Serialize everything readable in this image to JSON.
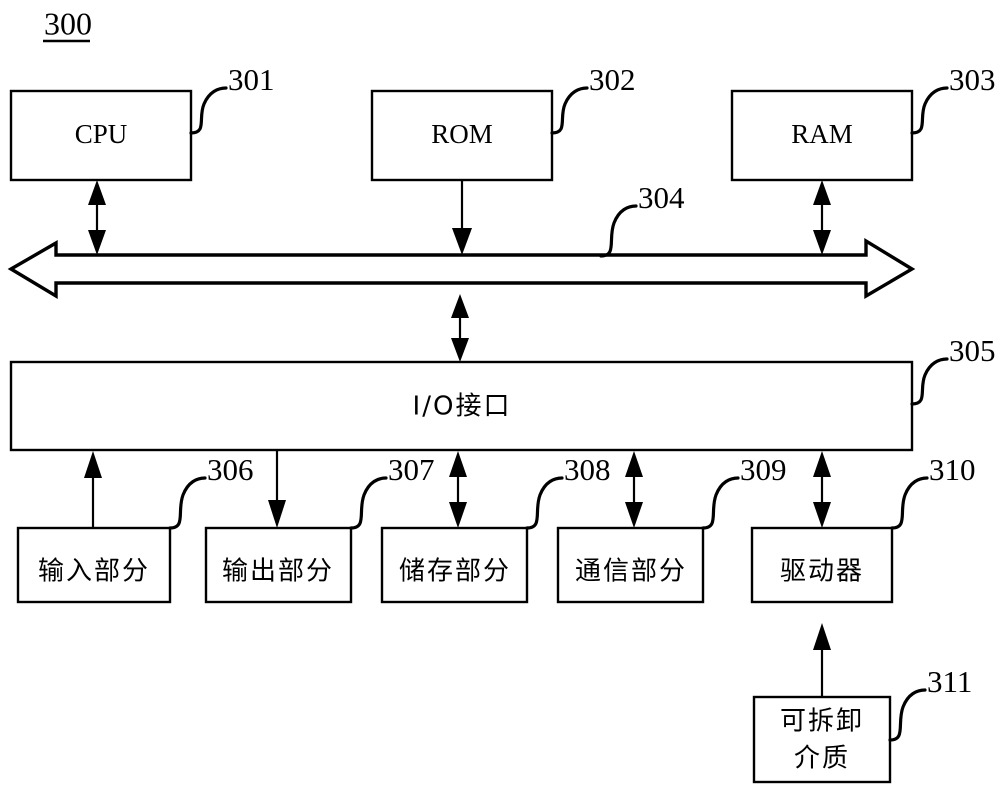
{
  "figure": {
    "number": "300",
    "title_underlined": true
  },
  "blocks": {
    "cpu": {
      "label": "CPU",
      "ref": "301"
    },
    "rom": {
      "label": "ROM",
      "ref": "302"
    },
    "ram": {
      "label": "RAM",
      "ref": "303"
    },
    "bus": {
      "label": "",
      "ref": "304"
    },
    "io_interface": {
      "label": "I/O接口",
      "ref": "305"
    },
    "input_part": {
      "label": "输入部分",
      "ref": "306"
    },
    "output_part": {
      "label": "输出部分",
      "ref": "307"
    },
    "storage_part": {
      "label": "储存部分",
      "ref": "308"
    },
    "communication_part": {
      "label": "通信部分",
      "ref": "309"
    },
    "driver": {
      "label": "驱动器",
      "ref": "310"
    },
    "removable_media": {
      "label_line1": "可拆卸",
      "label_line2": "介质",
      "ref": "311"
    }
  },
  "connections": [
    {
      "from": "cpu",
      "to": "bus",
      "direction": "bidirectional"
    },
    {
      "from": "rom",
      "to": "bus",
      "direction": "down"
    },
    {
      "from": "ram",
      "to": "bus",
      "direction": "bidirectional"
    },
    {
      "from": "bus",
      "to": "io_interface",
      "direction": "bidirectional"
    },
    {
      "from": "input_part",
      "to": "io_interface",
      "direction": "up"
    },
    {
      "from": "io_interface",
      "to": "output_part",
      "direction": "down"
    },
    {
      "from": "storage_part",
      "to": "io_interface",
      "direction": "bidirectional"
    },
    {
      "from": "communication_part",
      "to": "io_interface",
      "direction": "bidirectional"
    },
    {
      "from": "driver",
      "to": "io_interface",
      "direction": "bidirectional"
    },
    {
      "from": "removable_media",
      "to": "driver",
      "direction": "up"
    }
  ],
  "style": {
    "stroke_color": "#000000",
    "fill_color": "#ffffff",
    "background": "#ffffff"
  }
}
